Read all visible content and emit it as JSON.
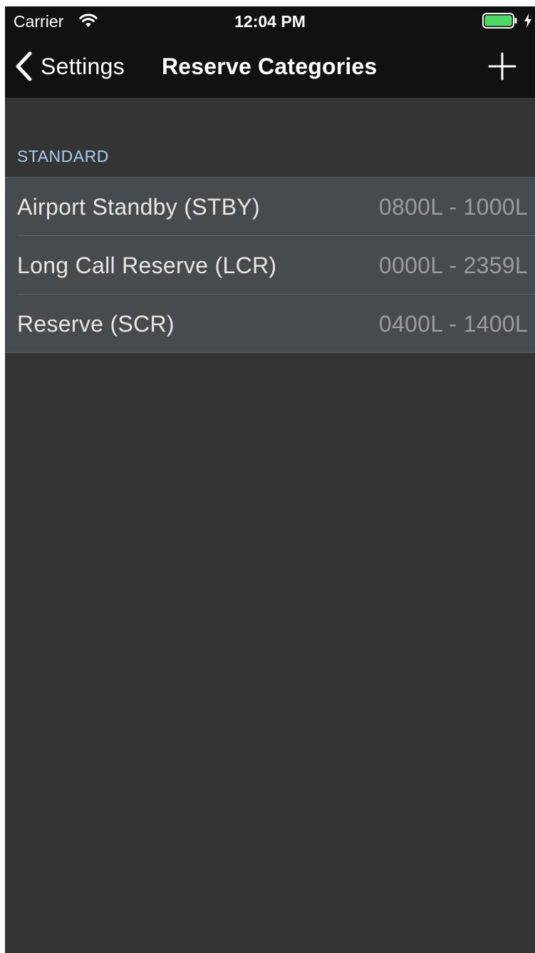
{
  "status_bar": {
    "carrier": "Carrier",
    "time": "12:04 PM",
    "wifi_icon": "wifi-icon",
    "battery_icon": "battery-full-icon",
    "charging_icon": "charging-bolt-icon",
    "battery_color": "#4cd964"
  },
  "nav_bar": {
    "back_label": "Settings",
    "back_icon": "chevron-left-icon",
    "title": "Reserve Categories",
    "add_icon": "plus-icon"
  },
  "section": {
    "header": "STANDARD"
  },
  "categories": [
    {
      "name": "Airport Standby (STBY)",
      "time_range": "0800L - 1000L"
    },
    {
      "name": "Long Call Reserve (LCR)",
      "time_range": "0000L - 2359L"
    },
    {
      "name": "Reserve (SCR)",
      "time_range": "0400L - 1400L"
    }
  ],
  "colors": {
    "background": "#343434",
    "nav_background": "#111111",
    "row_background": "#464b50",
    "section_header": "#a9cdf0"
  }
}
